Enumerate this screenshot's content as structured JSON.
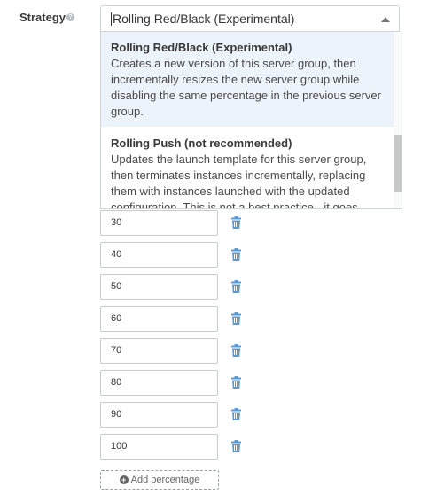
{
  "strategy": {
    "label": "Strategy",
    "help_icon": "question-circle-icon",
    "selected": "Rolling Red/Black (Experimental)"
  },
  "dropdown": {
    "options": [
      {
        "title": "Rolling Red/Black (Experimental)",
        "description": "Creates a new version of this server group, then incrementally resizes the new server group while disabling the same percentage in the previous server group."
      },
      {
        "title": "Rolling Push (not recommended)",
        "description": "Updates the launch template for this server group, then terminates instances incrementally, replacing them with instances launched with the updated configuration. This is not a best practice - it goes"
      }
    ]
  },
  "percentages": [
    "30",
    "40",
    "50",
    "60",
    "70",
    "80",
    "90",
    "100"
  ],
  "add_button": {
    "label": "Add percentage",
    "icon": "plus-circle-icon"
  },
  "colors": {
    "trash": "#5b9bd5",
    "highlight": "#edf3fb"
  }
}
